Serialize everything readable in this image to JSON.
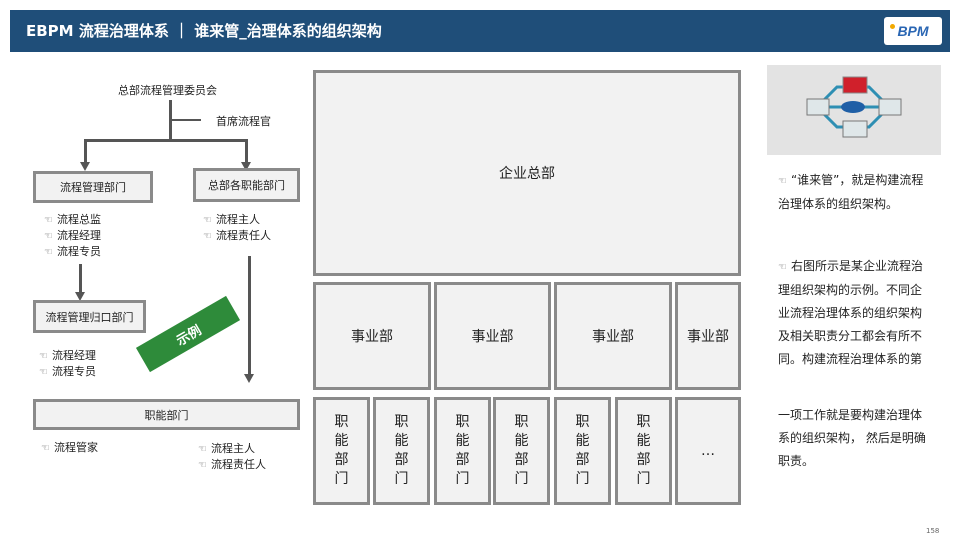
{
  "header": {
    "title": "EBPM 流程治理体系 ｜ 谁来管_治理体系的组织架构",
    "logo": "BPM",
    "bg_color": "#1f4e79"
  },
  "left_chart": {
    "top_node": "总部流程管理委员会",
    "chief_officer": "首席流程官",
    "process_dept": "流程管理部门",
    "hq_func_dept": "总部各职能部门",
    "process_dept_roles": [
      "流程总监",
      "流程经理",
      "流程专员"
    ],
    "hq_func_roles": [
      "流程主人",
      "流程责任人"
    ],
    "process_interface_dept": "流程管理归口部门",
    "interface_roles": [
      "流程经理",
      "流程专员"
    ],
    "func_dept": "职能部门",
    "func_dept_roles_left": [
      "流程管家"
    ],
    "func_dept_roles_right": [
      "流程主人",
      "流程责任人"
    ],
    "example_badge": "示例",
    "badge_color": "#2e8b3a"
  },
  "right_chart": {
    "hq": "企业总部",
    "business_units": [
      "事业部",
      "事业部",
      "事业部",
      "事业部"
    ],
    "func_depts": [
      "职能部门",
      "职能部门",
      "职能部门",
      "职能部门",
      "职能部门",
      "职能部门"
    ],
    "ellipsis": "…"
  },
  "side_text": {
    "p1": "“谁来管”，就是构建流程治理体系的组织架构。",
    "p2a": "右图所示是某企业流程治理组织架构的示例。不同企业流程治理体系的组织架构及相关职责分工都会有所不同。构建流程治理体系的第",
    "p2b": "一项工作就是要构建治理体系的组织架构， 然后是明确职责。"
  },
  "page_number": "158"
}
